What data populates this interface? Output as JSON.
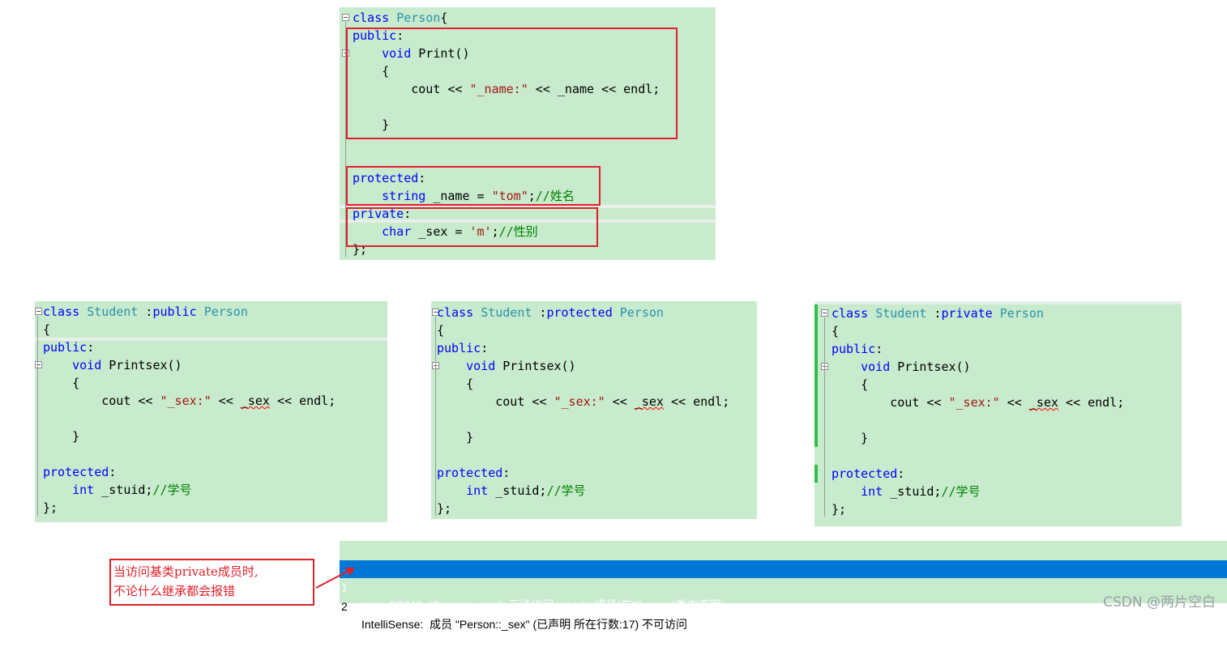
{
  "person_panel": {
    "lines": [
      [
        [
          "kw",
          "class"
        ],
        [
          "p",
          " "
        ],
        [
          "ty",
          "Person"
        ],
        [
          "p",
          "{"
        ]
      ],
      [
        [
          "kw",
          "public"
        ],
        [
          "p",
          ":"
        ]
      ],
      [
        [
          "p",
          "    "
        ],
        [
          "kw",
          "void"
        ],
        [
          "p",
          " Print()"
        ]
      ],
      [
        [
          "p",
          "    {"
        ]
      ],
      [
        [
          "p",
          "        cout << "
        ],
        [
          "str",
          "\"_name:\""
        ],
        [
          "p",
          " << _name << endl;"
        ]
      ],
      [
        [
          "p",
          ""
        ]
      ],
      [
        [
          "p",
          "    }"
        ]
      ],
      [
        [
          "p",
          ""
        ]
      ],
      [
        [
          "p",
          ""
        ]
      ],
      [
        [
          "kw",
          "protected"
        ],
        [
          "p",
          ":"
        ]
      ],
      [
        [
          "p",
          "    "
        ],
        [
          "kw",
          "string"
        ],
        [
          "p",
          " _name = "
        ],
        [
          "str",
          "\"tom\""
        ],
        [
          "p",
          ";"
        ],
        [
          "cm",
          "//姓名"
        ]
      ],
      [
        [
          "kw",
          "private"
        ],
        [
          "p",
          ":"
        ]
      ],
      [
        [
          "p",
          "    "
        ],
        [
          "kw",
          "char"
        ],
        [
          "p",
          " _sex = "
        ],
        [
          "str",
          "'m'"
        ],
        [
          "p",
          ";"
        ],
        [
          "cm",
          "//性别"
        ]
      ],
      [
        [
          "p",
          "};"
        ]
      ]
    ]
  },
  "student_public_panel": {
    "lines": [
      [
        [
          "kw",
          "class"
        ],
        [
          "p",
          " "
        ],
        [
          "ty",
          "Student"
        ],
        [
          "p",
          " :"
        ],
        [
          "kw",
          "public"
        ],
        [
          "p",
          " "
        ],
        [
          "ty",
          "Person"
        ]
      ],
      [
        [
          "p",
          "{"
        ]
      ],
      [
        [
          "kw",
          "public"
        ],
        [
          "p",
          ":"
        ]
      ],
      [
        [
          "p",
          "    "
        ],
        [
          "kw",
          "void"
        ],
        [
          "p",
          " Printsex()"
        ]
      ],
      [
        [
          "p",
          "    {"
        ]
      ],
      [
        [
          "p",
          "        cout << "
        ],
        [
          "str",
          "\"_sex:\""
        ],
        [
          "p",
          " << "
        ],
        [
          "sq",
          "_sex"
        ],
        [
          "p",
          " << endl;"
        ]
      ],
      [
        [
          "p",
          ""
        ]
      ],
      [
        [
          "p",
          "    }"
        ]
      ],
      [
        [
          "p",
          ""
        ]
      ],
      [
        [
          "kw",
          "protected"
        ],
        [
          "p",
          ":"
        ]
      ],
      [
        [
          "p",
          "    "
        ],
        [
          "kw",
          "int"
        ],
        [
          "p",
          " _stuid;"
        ],
        [
          "cm",
          "//学号"
        ]
      ],
      [
        [
          "p",
          "};"
        ]
      ]
    ]
  },
  "student_protected_panel": {
    "lines": [
      [
        [
          "kw",
          "class"
        ],
        [
          "p",
          " "
        ],
        [
          "ty",
          "Student"
        ],
        [
          "p",
          " :"
        ],
        [
          "kw",
          "protected"
        ],
        [
          "p",
          " "
        ],
        [
          "ty",
          "Person"
        ]
      ],
      [
        [
          "p",
          "{"
        ]
      ],
      [
        [
          "kw",
          "public"
        ],
        [
          "p",
          ":"
        ]
      ],
      [
        [
          "p",
          "    "
        ],
        [
          "kw",
          "void"
        ],
        [
          "p",
          " Printsex()"
        ]
      ],
      [
        [
          "p",
          "    {"
        ]
      ],
      [
        [
          "p",
          "        cout << "
        ],
        [
          "str",
          "\"_sex:\""
        ],
        [
          "p",
          " << "
        ],
        [
          "sq",
          "_sex"
        ],
        [
          "p",
          " << endl;"
        ]
      ],
      [
        [
          "p",
          ""
        ]
      ],
      [
        [
          "p",
          "    }"
        ]
      ],
      [
        [
          "p",
          ""
        ]
      ],
      [
        [
          "kw",
          "protected"
        ],
        [
          "p",
          ":"
        ]
      ],
      [
        [
          "p",
          "    "
        ],
        [
          "kw",
          "int"
        ],
        [
          "p",
          " _stuid;"
        ],
        [
          "cm",
          "//学号"
        ]
      ],
      [
        [
          "p",
          "};"
        ]
      ]
    ]
  },
  "student_private_panel": {
    "lines": [
      [
        [
          "kw",
          "class"
        ],
        [
          "p",
          " "
        ],
        [
          "ty",
          "Student"
        ],
        [
          "p",
          " :"
        ],
        [
          "kw",
          "private"
        ],
        [
          "p",
          " "
        ],
        [
          "ty",
          "Person"
        ]
      ],
      [
        [
          "p",
          "{"
        ]
      ],
      [
        [
          "kw",
          "public"
        ],
        [
          "p",
          ":"
        ]
      ],
      [
        [
          "p",
          "    "
        ],
        [
          "kw",
          "void"
        ],
        [
          "p",
          " Printsex()"
        ]
      ],
      [
        [
          "p",
          "    {"
        ]
      ],
      [
        [
          "p",
          "        cout << "
        ],
        [
          "str",
          "\"_sex:\""
        ],
        [
          "p",
          " << "
        ],
        [
          "sq",
          "_sex"
        ],
        [
          "p",
          " << endl;"
        ]
      ],
      [
        [
          "p",
          ""
        ]
      ],
      [
        [
          "p",
          "    }"
        ]
      ],
      [
        [
          "p",
          ""
        ]
      ],
      [
        [
          "kw",
          "protected"
        ],
        [
          "p",
          ":"
        ]
      ],
      [
        [
          "p",
          "    "
        ],
        [
          "kw",
          "int"
        ],
        [
          "p",
          " _stuid;"
        ],
        [
          "cm",
          "//学号"
        ]
      ],
      [
        [
          "p",
          "};"
        ]
      ]
    ]
  },
  "errors": [
    {
      "num": "1",
      "text": "error C2248: “Person::_sex”: 无法访问 private 成员(在“Person”类中声明)"
    },
    {
      "num": "2",
      "text": "IntelliSense:  成员 \"Person::_sex\" (已声明 所在行数:17) 不可访问"
    }
  ],
  "annotation": {
    "line1": "当访问基类private成员时,",
    "line2": "不论什么继承都会报错"
  },
  "watermark": "CSDN @两片空白",
  "colors": {
    "panel_bg": "#c7ebcc",
    "keyword": "#0000ff",
    "type": "#2b91af",
    "string": "#a31515",
    "comment": "#008000",
    "selection": "#0078d7",
    "annotation_red": "#e0202a"
  }
}
